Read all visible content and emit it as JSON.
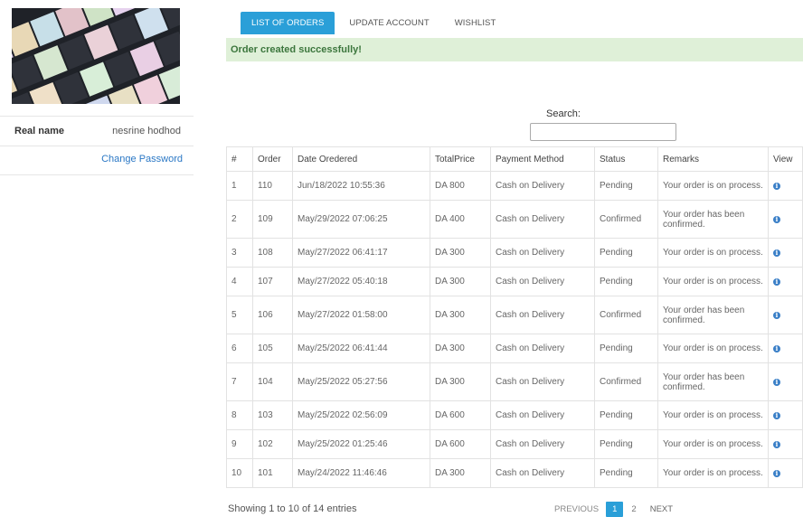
{
  "sidebar": {
    "profile": {
      "label": "Real name",
      "value": "nesrine hodhod"
    },
    "change_password": "Change Password"
  },
  "tabs": [
    {
      "label": "LIST OF ORDERS",
      "active": true
    },
    {
      "label": "UPDATE ACCOUNT",
      "active": false
    },
    {
      "label": "WISHLIST",
      "active": false
    }
  ],
  "alert": {
    "message": "Order created successfully!"
  },
  "search": {
    "label": "Search:",
    "value": ""
  },
  "table": {
    "headers": [
      "#",
      "Order",
      "Date Oredered",
      "TotalPrice",
      "Payment Method",
      "Status",
      "Remarks",
      "View"
    ],
    "rows": [
      {
        "n": "1",
        "order": "110",
        "date": "Jun/18/2022 10:55:36",
        "price": "DA 800",
        "payment": "Cash on Delivery",
        "status": "Pending",
        "remarks": "Your order is on process."
      },
      {
        "n": "2",
        "order": "109",
        "date": "May/29/2022 07:06:25",
        "price": "DA 400",
        "payment": "Cash on Delivery",
        "status": "Confirmed",
        "remarks": "Your order has been confirmed."
      },
      {
        "n": "3",
        "order": "108",
        "date": "May/27/2022 06:41:17",
        "price": "DA 300",
        "payment": "Cash on Delivery",
        "status": "Pending",
        "remarks": "Your order is on process."
      },
      {
        "n": "4",
        "order": "107",
        "date": "May/27/2022 05:40:18",
        "price": "DA 300",
        "payment": "Cash on Delivery",
        "status": "Pending",
        "remarks": "Your order is on process."
      },
      {
        "n": "5",
        "order": "106",
        "date": "May/27/2022 01:58:00",
        "price": "DA 300",
        "payment": "Cash on Delivery",
        "status": "Confirmed",
        "remarks": "Your order has been confirmed."
      },
      {
        "n": "6",
        "order": "105",
        "date": "May/25/2022 06:41:44",
        "price": "DA 300",
        "payment": "Cash on Delivery",
        "status": "Pending",
        "remarks": "Your order is on process."
      },
      {
        "n": "7",
        "order": "104",
        "date": "May/25/2022 05:27:56",
        "price": "DA 300",
        "payment": "Cash on Delivery",
        "status": "Confirmed",
        "remarks": "Your order has been confirmed."
      },
      {
        "n": "8",
        "order": "103",
        "date": "May/25/2022 02:56:09",
        "price": "DA 600",
        "payment": "Cash on Delivery",
        "status": "Pending",
        "remarks": "Your order is on process."
      },
      {
        "n": "9",
        "order": "102",
        "date": "May/25/2022 01:25:46",
        "price": "DA 600",
        "payment": "Cash on Delivery",
        "status": "Pending",
        "remarks": "Your order is on process."
      },
      {
        "n": "10",
        "order": "101",
        "date": "May/24/2022 11:46:46",
        "price": "DA 300",
        "payment": "Cash on Delivery",
        "status": "Pending",
        "remarks": "Your order is on process."
      }
    ]
  },
  "footer": {
    "showing": "Showing 1 to 10 of 14 entries",
    "previous": "PREVIOUS",
    "pages": [
      "1",
      "2"
    ],
    "next": "NEXT"
  },
  "colors": {
    "accent": "#2a9fd8",
    "alert_bg": "#dff0d8",
    "alert_text": "#3c763d",
    "link": "#2b78c5"
  },
  "icons": {
    "view": "info-circle-icon"
  }
}
